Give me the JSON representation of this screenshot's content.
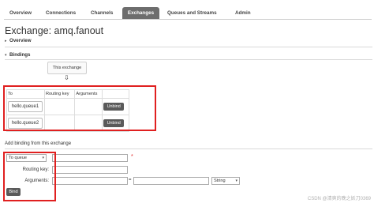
{
  "nav": {
    "tabs": [
      {
        "label": "Overview",
        "active": false
      },
      {
        "label": "Connections",
        "active": false
      },
      {
        "label": "Channels",
        "active": false
      },
      {
        "label": "Exchanges",
        "active": true
      },
      {
        "label": "Queues and Streams",
        "active": false
      },
      {
        "label": "Admin",
        "active": false
      }
    ]
  },
  "page": {
    "title": "Exchange: amq.fanout"
  },
  "sections": {
    "overview": "Overview",
    "bindings": "Bindings"
  },
  "bindings": {
    "source_label": "This exchange",
    "arrow": "⇩",
    "columns": [
      "To",
      "Routing key",
      "Arguments",
      ""
    ],
    "rows": [
      {
        "to": "hello.queue1",
        "routing_key": "",
        "arguments": "",
        "action": "Unbind"
      },
      {
        "to": "hello.queue2",
        "routing_key": "",
        "arguments": "",
        "action": "Unbind"
      }
    ]
  },
  "add_binding": {
    "title": "Add binding from this exchange",
    "destination_type": "To queue",
    "required_marker": "*",
    "routing_key_label": "Routing key:",
    "arguments_label": "Arguments:",
    "equals": "=",
    "arg_type": "String",
    "bind_label": "Bind"
  },
  "watermark": "CSDN @清爽的晚之妖刀0369",
  "colors": {
    "active_tab": "#6d6d6d",
    "button": "#5a5a5a",
    "highlight": "#e02020"
  }
}
